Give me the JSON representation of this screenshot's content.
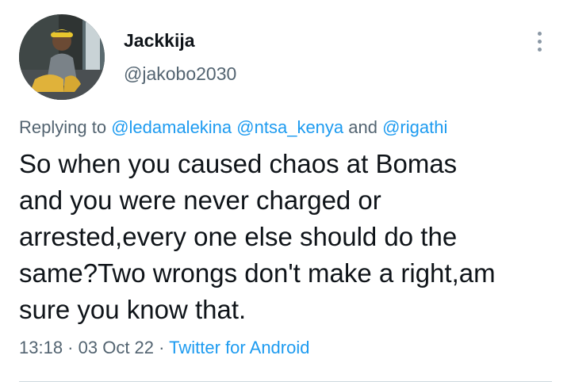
{
  "author": {
    "display_name": "Jackkija",
    "handle": "@jakobo2030",
    "avatar_icon": "user-avatar-photo"
  },
  "more_icon": "vertical-ellipsis-icon",
  "reply": {
    "prefix": "Replying to ",
    "mention_1": "@ledamalekina",
    "mention_2": "@ntsa_kenya",
    "conjunction": " and ",
    "mention_3": "@rigathi"
  },
  "tweet": {
    "text": "So when you caused chaos at Bomas\nand you were never charged or\narrested,every one else should do the\nsame?Two wrongs don't make a right,am\nsure you know that."
  },
  "meta": {
    "time": "13:18",
    "separator_1": " · ",
    "date": "03 Oct 22",
    "separator_2": " · ",
    "source": "Twitter for Android"
  },
  "colors": {
    "link": "#1d9bf0",
    "secondary_text": "#536471",
    "primary_text": "#0f1419"
  }
}
